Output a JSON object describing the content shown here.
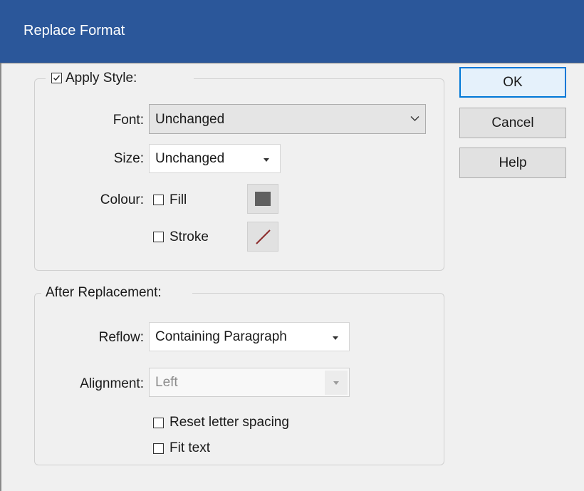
{
  "dialog": {
    "title": "Replace Format"
  },
  "apply_style": {
    "label": "Apply Style:",
    "checked": true,
    "font": {
      "label": "Font:",
      "value": "Unchanged"
    },
    "size": {
      "label": "Size:",
      "value": "Unchanged"
    },
    "colour": {
      "label": "Colour:",
      "fill_label": "Fill",
      "fill_checked": false,
      "fill_color": "#606060",
      "stroke_label": "Stroke",
      "stroke_checked": false,
      "stroke_color": "#8b2a2a"
    }
  },
  "after_replacement": {
    "label": "After Replacement:",
    "reflow": {
      "label": "Reflow:",
      "value": "Containing Paragraph"
    },
    "alignment": {
      "label": "Alignment:",
      "value": "Left",
      "enabled": false
    },
    "reset_letter_spacing": {
      "label": "Reset letter spacing",
      "checked": false
    },
    "fit_text": {
      "label": "Fit text",
      "checked": false
    }
  },
  "buttons": {
    "ok": "OK",
    "cancel": "Cancel",
    "help": "Help"
  },
  "colors": {
    "title_bar": "#2b579a",
    "dialog_bg": "#f0f0f0",
    "default_button_border": "#0078d7"
  }
}
